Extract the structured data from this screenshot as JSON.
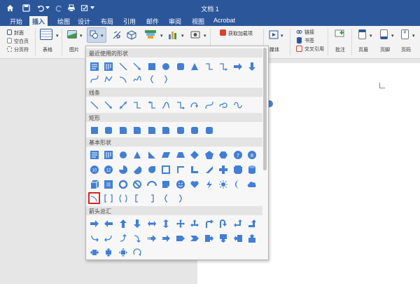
{
  "window": {
    "title": "文档 1"
  },
  "tabs": [
    "开始",
    "插入",
    "绘图",
    "设计",
    "布局",
    "引用",
    "邮件",
    "审阅",
    "视图",
    "Acrobat"
  ],
  "active_tab": "插入",
  "ribbon": {
    "cover": "封面",
    "blank_page": "空白页",
    "page_break": "分页符",
    "table": "表格",
    "picture": "图片",
    "get_addins": "获取加载项",
    "media": "媒体",
    "link": "链接",
    "bookmark": "书签",
    "cross_ref": "交叉引用",
    "comment": "批注",
    "header": "页眉",
    "footer": "页脚",
    "page_number": "页码"
  },
  "shapes_menu": {
    "sections": [
      "最近使用的形状",
      "线条",
      "矩形",
      "基本形状",
      "箭头总汇"
    ],
    "selected_shape": "arc-shape"
  },
  "colors": {
    "titlebar": "#2b579a",
    "shape_blue": "#3f7fd9",
    "selection_red": "#e02020"
  }
}
